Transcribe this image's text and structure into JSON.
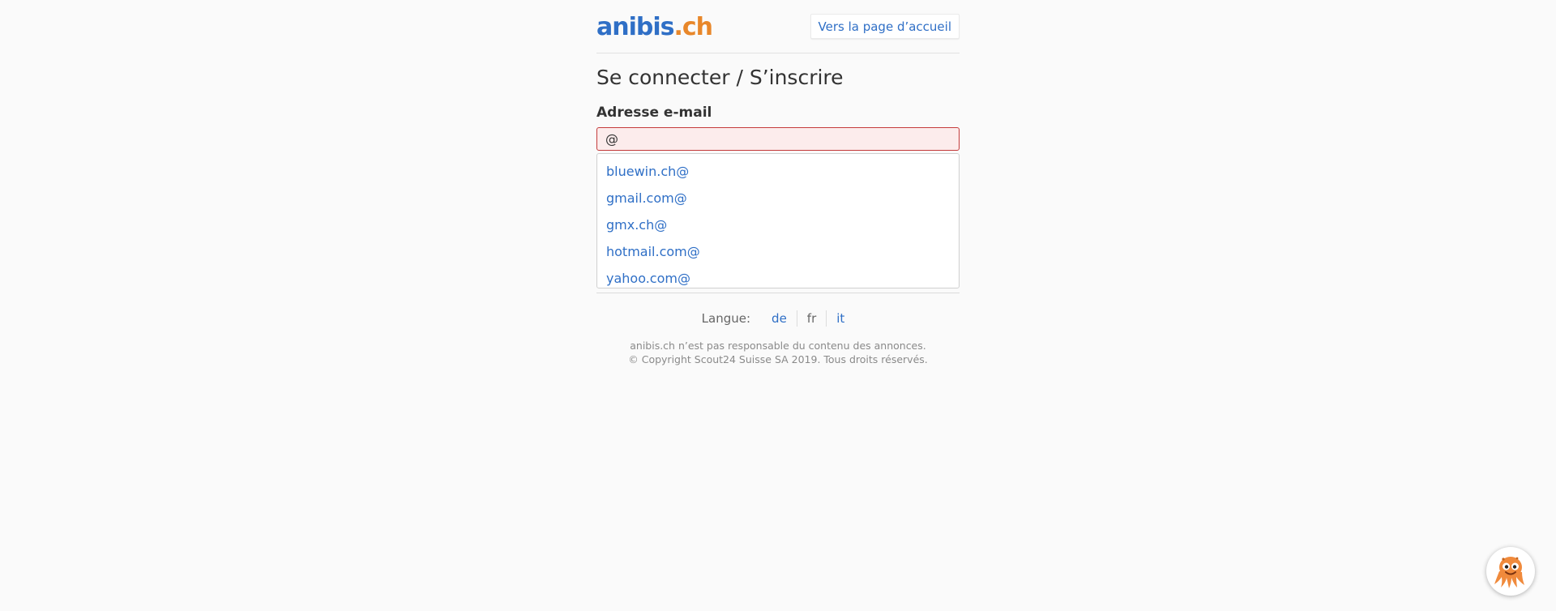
{
  "header": {
    "logo_part1": "anibis",
    "logo_part2": ".ch",
    "home_link": "Vers la page d’accueil"
  },
  "main": {
    "title": "Se connecter / S’inscrire",
    "email_label": "Adresse e-mail",
    "email_value": "@",
    "suggestions": [
      "bluewin.ch@",
      "gmail.com@",
      "gmx.ch@",
      "hotmail.com@",
      "yahoo.com@"
    ]
  },
  "language": {
    "label": "Langue:",
    "options": [
      {
        "code": "de",
        "active": false
      },
      {
        "code": "fr",
        "active": true
      },
      {
        "code": "it",
        "active": false
      }
    ]
  },
  "footer": {
    "disclaimer": "anibis.ch n’est pas responsable du contenu des annonces.",
    "copyright": "© Copyright Scout24 Suisse SA 2019. Tous droits réservés."
  },
  "colors": {
    "link": "#2f6fc6",
    "logo_accent": "#e8872a",
    "error_border": "#c43b3b",
    "error_bg": "#fcecec",
    "mascot": "#f08a3c"
  },
  "icons": {
    "mascot": "octopus-mascot-icon"
  }
}
